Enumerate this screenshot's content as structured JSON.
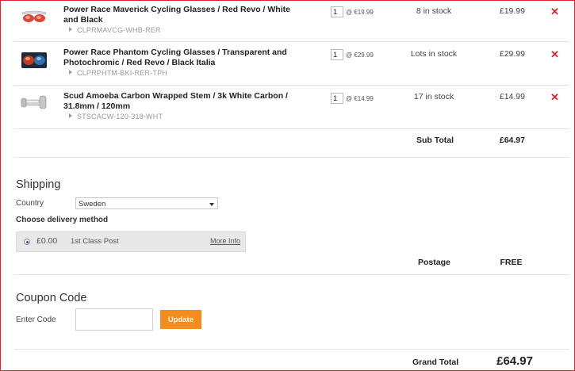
{
  "cart": {
    "items": [
      {
        "name": "Power Race Maverick Cycling Glasses / Red Revo / White and Black",
        "sku": "CLPRMAVCG-WHB-RER",
        "qty": "1",
        "each_price": "@ €19.99",
        "stock": "8 in stock",
        "price": "£19.99",
        "remove": "✕"
      },
      {
        "name": "Power Race Phantom Cycling Glasses / Transparent and Photochromic / Red Revo / Black Italia",
        "sku": "CLPRPHTM-BKI-RER-TPH",
        "qty": "1",
        "each_price": "@ €29.99",
        "stock": "Lots in stock",
        "price": "£29.99",
        "remove": "✕"
      },
      {
        "name": "Scud Amoeba Carbon Wrapped Stem / 3k White Carbon / 31.8mm / 120mm",
        "sku": "STSCACW-120-318-WHT",
        "qty": "1",
        "each_price": "@ €14.99",
        "stock": "17 in stock",
        "price": "£14.99",
        "remove": "✕"
      }
    ],
    "subtotal_label": "Sub Total",
    "subtotal_value": "£64.97"
  },
  "shipping": {
    "title": "Shipping",
    "country_label": "Country",
    "country_value": "Sweden",
    "delivery_label": "Choose delivery method",
    "method_price": "£0.00",
    "method_name": "1st Class Post",
    "more_info": "More Info",
    "postage_label": "Postage",
    "postage_value": "FREE"
  },
  "coupon": {
    "title": "Coupon Code",
    "enter_label": "Enter Code",
    "input_value": "",
    "update_label": "Update"
  },
  "total": {
    "label": "Grand Total",
    "value": "£64.97"
  },
  "colors": {
    "accent_red": "#d9252b",
    "button_orange": "#f28d1e"
  }
}
